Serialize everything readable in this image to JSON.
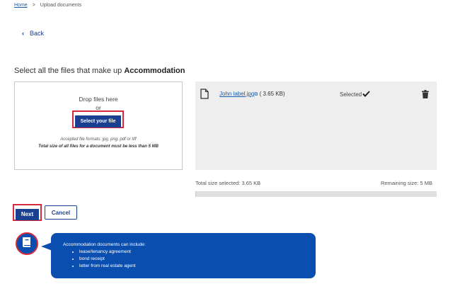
{
  "breadcrumb": {
    "home": "Home",
    "separator": ">",
    "current": "Upload documents"
  },
  "back": {
    "label": "Back"
  },
  "heading": {
    "prefix": "Select all the files that make up ",
    "bold": "Accommodation"
  },
  "dropzone": {
    "drop_text": "Drop files here",
    "or_text": "or",
    "select_button": "Select your file",
    "accepted": "Accepted file formats: jpg, png, pdf or tiff",
    "limit": "Total size of all files for a document must be less than 5 MB"
  },
  "file": {
    "name": "John label.jpg",
    "size": "( 3.65 KB)",
    "status": "Selected"
  },
  "totals": {
    "selected": "Total size selected: 3.65 KB",
    "remaining": "Remaining size: 5 MB",
    "used_fraction": 0.0007
  },
  "actions": {
    "next": "Next",
    "cancel": "Cancel"
  },
  "info": {
    "title": "Accommodation documents can include:",
    "items": [
      "lease/tenancy agreement",
      "bond receipt",
      "letter from real estate agent"
    ]
  },
  "colors": {
    "primary": "#1b3f91",
    "accent": "#0a4fb0",
    "highlight": "#d6293b"
  },
  "icons": {
    "back": "chevron-left-icon",
    "file": "file-icon",
    "external": "external-link-icon",
    "check": "check-icon",
    "delete": "trash-icon",
    "info": "book-icon"
  }
}
